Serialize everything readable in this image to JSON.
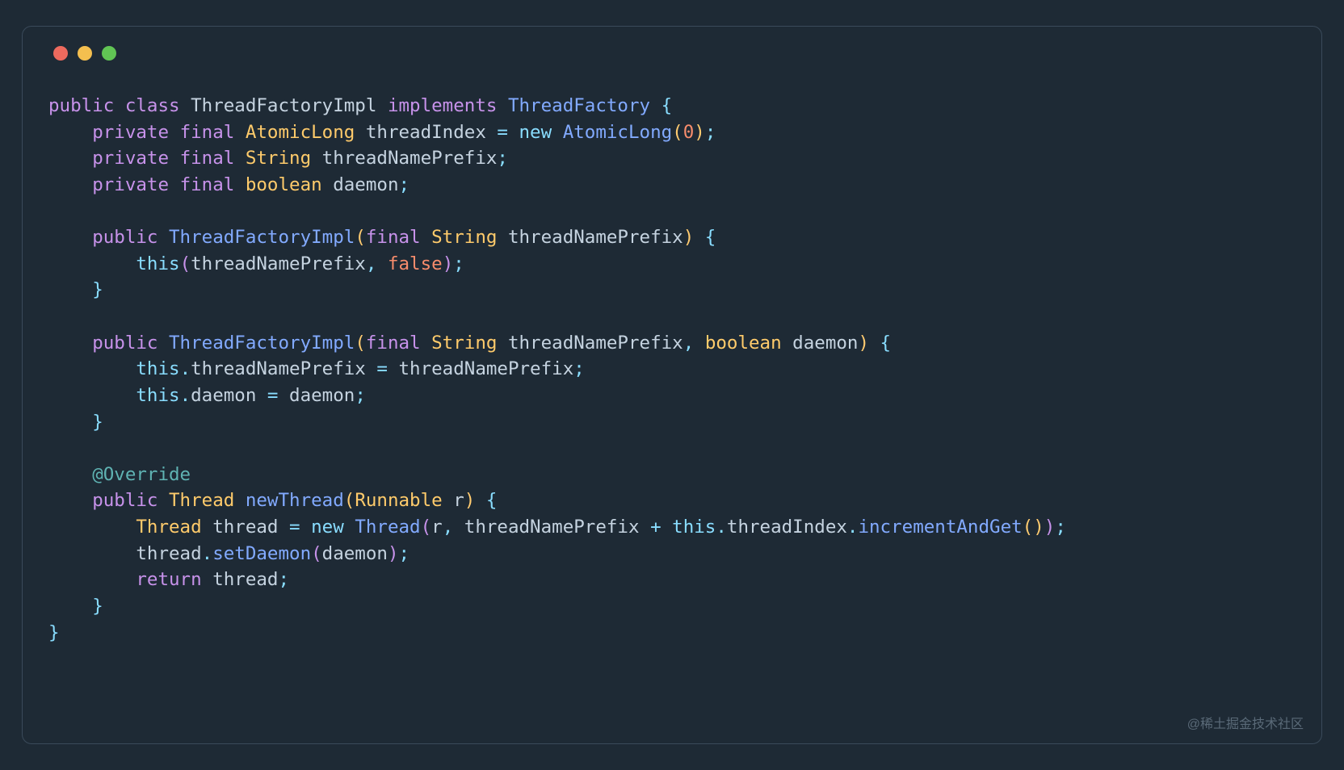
{
  "colors": {
    "background": "#1e2a35",
    "border": "#3a4a5a",
    "trafficRed": "#ed6a5e",
    "trafficYellow": "#f4bf4f",
    "trafficGreen": "#61c554",
    "keyword": "#c792ea",
    "typeClass": "#ffcb6b",
    "typeUser": "#82aaff",
    "identifier": "#c5d3e0",
    "punctuation": "#89ddff",
    "number": "#f78c6c",
    "annotation": "#5fb3b3"
  },
  "watermark": "@稀土掘金技术社区",
  "code": {
    "lines": [
      [
        {
          "t": "public ",
          "c": "kw-mod"
        },
        {
          "t": "class ",
          "c": "kw-storage"
        },
        {
          "t": "ThreadFactoryImpl",
          "c": "ident"
        },
        {
          "t": " implements ",
          "c": "kw-mod"
        },
        {
          "t": "ThreadFactory",
          "c": "type-user"
        },
        {
          "t": " {",
          "c": "punct"
        }
      ],
      [
        {
          "t": "    ",
          "c": ""
        },
        {
          "t": "private ",
          "c": "kw-mod"
        },
        {
          "t": "final ",
          "c": "kw-mod"
        },
        {
          "t": "AtomicLong",
          "c": "type-class"
        },
        {
          "t": " threadIndex ",
          "c": "ident"
        },
        {
          "t": "= ",
          "c": "op"
        },
        {
          "t": "new ",
          "c": "new"
        },
        {
          "t": "AtomicLong",
          "c": "type-user"
        },
        {
          "t": "(",
          "c": "paren"
        },
        {
          "t": "0",
          "c": "num"
        },
        {
          "t": ")",
          "c": "paren"
        },
        {
          "t": ";",
          "c": "punct"
        }
      ],
      [
        {
          "t": "    ",
          "c": ""
        },
        {
          "t": "private ",
          "c": "kw-mod"
        },
        {
          "t": "final ",
          "c": "kw-mod"
        },
        {
          "t": "String",
          "c": "type-class"
        },
        {
          "t": " threadNamePrefix",
          "c": "ident"
        },
        {
          "t": ";",
          "c": "punct"
        }
      ],
      [
        {
          "t": "    ",
          "c": ""
        },
        {
          "t": "private ",
          "c": "kw-mod"
        },
        {
          "t": "final ",
          "c": "kw-mod"
        },
        {
          "t": "boolean",
          "c": "type-class"
        },
        {
          "t": " daemon",
          "c": "ident"
        },
        {
          "t": ";",
          "c": "punct"
        }
      ],
      [
        {
          "t": "",
          "c": ""
        }
      ],
      [
        {
          "t": "    ",
          "c": ""
        },
        {
          "t": "public ",
          "c": "kw-mod"
        },
        {
          "t": "ThreadFactoryImpl",
          "c": "type-user"
        },
        {
          "t": "(",
          "c": "paren"
        },
        {
          "t": "final ",
          "c": "kw-mod"
        },
        {
          "t": "String",
          "c": "type-class"
        },
        {
          "t": " threadNamePrefix",
          "c": "ident"
        },
        {
          "t": ")",
          "c": "paren"
        },
        {
          "t": " {",
          "c": "punct"
        }
      ],
      [
        {
          "t": "        ",
          "c": ""
        },
        {
          "t": "this",
          "c": "this"
        },
        {
          "t": "(",
          "c": "paren-p"
        },
        {
          "t": "threadNamePrefix",
          "c": "ident"
        },
        {
          "t": ",",
          "c": "punct"
        },
        {
          "t": " ",
          "c": ""
        },
        {
          "t": "false",
          "c": "bool"
        },
        {
          "t": ")",
          "c": "paren-p"
        },
        {
          "t": ";",
          "c": "punct"
        }
      ],
      [
        {
          "t": "    ",
          "c": ""
        },
        {
          "t": "}",
          "c": "punct"
        }
      ],
      [
        {
          "t": "",
          "c": ""
        }
      ],
      [
        {
          "t": "    ",
          "c": ""
        },
        {
          "t": "public ",
          "c": "kw-mod"
        },
        {
          "t": "ThreadFactoryImpl",
          "c": "type-user"
        },
        {
          "t": "(",
          "c": "paren"
        },
        {
          "t": "final ",
          "c": "kw-mod"
        },
        {
          "t": "String",
          "c": "type-class"
        },
        {
          "t": " threadNamePrefix",
          "c": "ident"
        },
        {
          "t": ",",
          "c": "punct"
        },
        {
          "t": " ",
          "c": ""
        },
        {
          "t": "boolean",
          "c": "type-class"
        },
        {
          "t": " daemon",
          "c": "ident"
        },
        {
          "t": ")",
          "c": "paren"
        },
        {
          "t": " {",
          "c": "punct"
        }
      ],
      [
        {
          "t": "        ",
          "c": ""
        },
        {
          "t": "this",
          "c": "this"
        },
        {
          "t": ".",
          "c": "punct"
        },
        {
          "t": "threadNamePrefix",
          "c": "ident"
        },
        {
          "t": " = ",
          "c": "op"
        },
        {
          "t": "threadNamePrefix",
          "c": "ident"
        },
        {
          "t": ";",
          "c": "punct"
        }
      ],
      [
        {
          "t": "        ",
          "c": ""
        },
        {
          "t": "this",
          "c": "this"
        },
        {
          "t": ".",
          "c": "punct"
        },
        {
          "t": "daemon",
          "c": "ident"
        },
        {
          "t": " = ",
          "c": "op"
        },
        {
          "t": "daemon",
          "c": "ident"
        },
        {
          "t": ";",
          "c": "punct"
        }
      ],
      [
        {
          "t": "    ",
          "c": ""
        },
        {
          "t": "}",
          "c": "punct"
        }
      ],
      [
        {
          "t": "",
          "c": ""
        }
      ],
      [
        {
          "t": "    ",
          "c": ""
        },
        {
          "t": "@Override",
          "c": "annot"
        }
      ],
      [
        {
          "t": "    ",
          "c": ""
        },
        {
          "t": "public ",
          "c": "kw-mod"
        },
        {
          "t": "Thread",
          "c": "type-class"
        },
        {
          "t": " ",
          "c": ""
        },
        {
          "t": "newThread",
          "c": "method"
        },
        {
          "t": "(",
          "c": "paren"
        },
        {
          "t": "Runnable",
          "c": "type-class"
        },
        {
          "t": " r",
          "c": "ident"
        },
        {
          "t": ")",
          "c": "paren"
        },
        {
          "t": " {",
          "c": "punct"
        }
      ],
      [
        {
          "t": "        ",
          "c": ""
        },
        {
          "t": "Thread",
          "c": "type-class"
        },
        {
          "t": " thread ",
          "c": "ident"
        },
        {
          "t": "= ",
          "c": "op"
        },
        {
          "t": "new ",
          "c": "new"
        },
        {
          "t": "Thread",
          "c": "type-user"
        },
        {
          "t": "(",
          "c": "paren-p"
        },
        {
          "t": "r",
          "c": "ident"
        },
        {
          "t": ",",
          "c": "punct"
        },
        {
          "t": " threadNamePrefix ",
          "c": "ident"
        },
        {
          "t": "+ ",
          "c": "op"
        },
        {
          "t": "this",
          "c": "this"
        },
        {
          "t": ".",
          "c": "punct"
        },
        {
          "t": "threadIndex",
          "c": "ident"
        },
        {
          "t": ".",
          "c": "punct"
        },
        {
          "t": "incrementAndGet",
          "c": "method"
        },
        {
          "t": "(",
          "c": "paren"
        },
        {
          "t": ")",
          "c": "paren"
        },
        {
          "t": ")",
          "c": "paren-p"
        },
        {
          "t": ";",
          "c": "punct"
        }
      ],
      [
        {
          "t": "        ",
          "c": ""
        },
        {
          "t": "thread",
          "c": "ident"
        },
        {
          "t": ".",
          "c": "punct"
        },
        {
          "t": "setDaemon",
          "c": "method"
        },
        {
          "t": "(",
          "c": "paren-p"
        },
        {
          "t": "daemon",
          "c": "ident"
        },
        {
          "t": ")",
          "c": "paren-p"
        },
        {
          "t": ";",
          "c": "punct"
        }
      ],
      [
        {
          "t": "        ",
          "c": ""
        },
        {
          "t": "return ",
          "c": "kw-ctrl"
        },
        {
          "t": "thread",
          "c": "ident"
        },
        {
          "t": ";",
          "c": "punct"
        }
      ],
      [
        {
          "t": "    ",
          "c": ""
        },
        {
          "t": "}",
          "c": "punct"
        }
      ],
      [
        {
          "t": "}",
          "c": "punct"
        }
      ]
    ]
  }
}
